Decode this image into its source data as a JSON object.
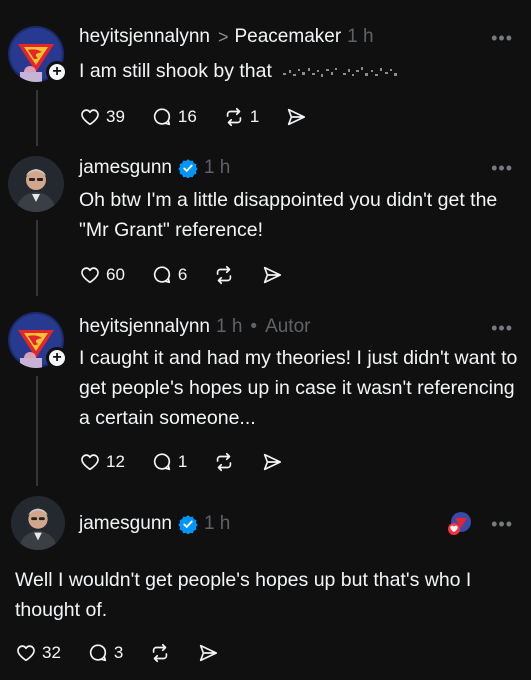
{
  "posts": [
    {
      "username": "heyitsjennalynn",
      "topic": "Peacemaker",
      "time": "1 h",
      "text": "I am still shook by that",
      "likes": "39",
      "replies": "16",
      "reposts": "1"
    },
    {
      "username": "jamesgunn",
      "time": "1 h",
      "text": "Oh btw I'm a little disappointed you didn't get the \"Mr Grant\" reference!",
      "likes": "60",
      "replies": "6"
    },
    {
      "username": "heyitsjennalynn",
      "time": "1 h",
      "author_tag": "Autor",
      "text": "I caught it and had my theories! I just didn't want to get people's hopes up in case it wasn't referencing a certain someone...",
      "likes": "12",
      "replies": "1"
    },
    {
      "username": "jamesgunn",
      "time": "1 h",
      "text": "Well I wouldn't get people's hopes up but that's who I thought of.",
      "likes": "32",
      "replies": "3"
    }
  ],
  "ui": {
    "more_label": "•••",
    "chevron": ">",
    "separator": "•",
    "plus": "+"
  },
  "colors": {
    "background": "#101010",
    "text": "#f3f5f7",
    "muted": "#5f6266",
    "verified": "#0095f6",
    "thread_line": "#333638"
  }
}
